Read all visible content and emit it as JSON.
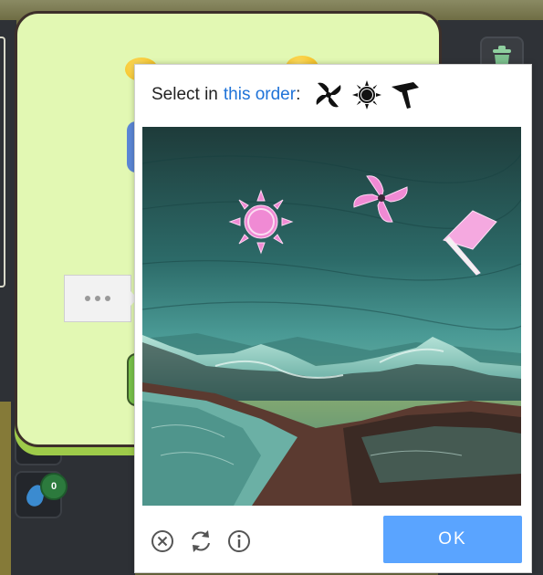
{
  "captcha": {
    "instruction_prefix": "Select in",
    "instruction_link": "this order",
    "instruction_suffix": ":",
    "sequence_icons": [
      "pinwheel-icon",
      "sun-icon",
      "flag-icon"
    ],
    "targets": [
      "sun-target-icon",
      "pinwheel-target-icon",
      "flag-target-icon"
    ],
    "ok_label": "OK",
    "footer_icons": [
      "close-circle-icon",
      "refresh-icon",
      "info-icon"
    ]
  },
  "background": {
    "inventory_badge_count": "0"
  },
  "colors": {
    "accent_link": "#1f73d8",
    "ok_button": "#5aa4ff",
    "target_pink": "#f08ad4",
    "modal_bg": "#e2f8b3"
  }
}
